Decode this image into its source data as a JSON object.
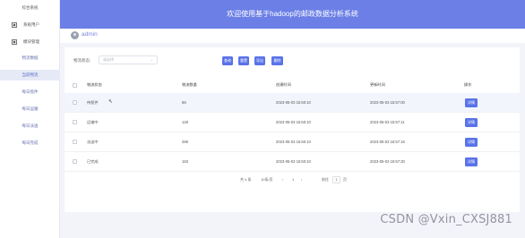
{
  "sidebar": {
    "title": "综合系统",
    "items": [
      {
        "label": "系统用户",
        "icon": "users-icon"
      },
      {
        "label": "模块管理",
        "icon": "module-icon"
      }
    ],
    "sub_items": [
      {
        "label": "物流数据",
        "active": false
      },
      {
        "label": "当前物流",
        "active": true
      },
      {
        "label": "每日揽件",
        "active": false
      },
      {
        "label": "每日运输",
        "active": false
      },
      {
        "label": "每日派送",
        "active": false
      },
      {
        "label": "每日完成",
        "active": false
      }
    ]
  },
  "header": {
    "title": "欢迎使用基于hadoop的邮政数据分析系统"
  },
  "user": {
    "name": "admin"
  },
  "filter": {
    "label": "物流状态:",
    "placeholder": "请选择"
  },
  "toolbar": {
    "buttons": [
      "查询",
      "重置",
      "导出",
      "删除"
    ]
  },
  "table": {
    "columns": [
      "物流状态",
      "物流数量",
      "创建时间",
      "更新时间",
      "操作"
    ],
    "rows": [
      {
        "status": "待揽件",
        "count": "68",
        "created": "2023-05-03 15:50:10",
        "updated": "2023-05-03 15:57:00",
        "action": "详情"
      },
      {
        "status": "运输中",
        "count": "128",
        "created": "2023-05-03 15:50:10",
        "updated": "2023-05-03 15:57:11",
        "action": "详情"
      },
      {
        "status": "派送中",
        "count": "286",
        "created": "2023-05-03 15:50:10",
        "updated": "2023-05-03 15:57:16",
        "action": "详情"
      },
      {
        "status": "已完成",
        "count": "163",
        "created": "2023-05-03 15:50:10",
        "updated": "2023-05-03 15:57:30",
        "action": "详情"
      }
    ]
  },
  "pagination": {
    "total": "共 4 条",
    "page_size": "10条/页",
    "prev": "‹",
    "current_page": "1",
    "next": "›",
    "goto_prefix": "前往",
    "goto_value": "1",
    "goto_suffix": "页"
  },
  "watermark": {
    "text": "CSDN @Vxin_CXSJ881"
  },
  "colors": {
    "header": "#6b7fe6",
    "primary_button": "#5a73e8",
    "active_menu_bg": "#e6eaf7"
  }
}
